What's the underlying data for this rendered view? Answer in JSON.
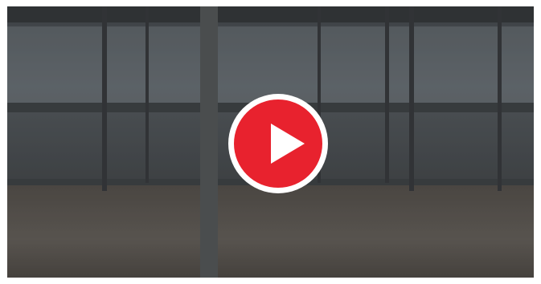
{
  "video": {
    "thumbnail": "office-atrium-scene",
    "overlay_color": "#e8222e",
    "play_icon": "play-icon"
  }
}
